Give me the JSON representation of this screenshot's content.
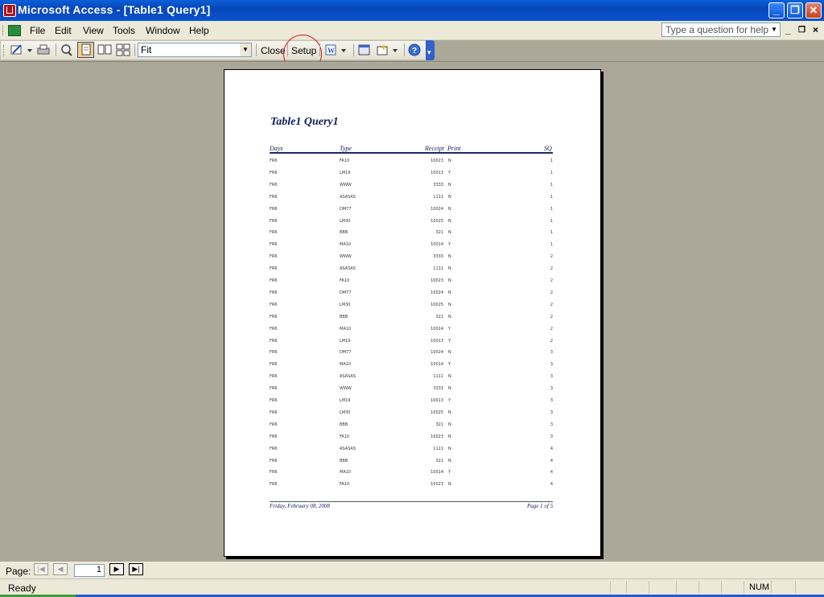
{
  "window": {
    "title": "Microsoft Access - [Table1 Query1]"
  },
  "menu": {
    "file": "File",
    "edit": "Edit",
    "view": "View",
    "tools": "Tools",
    "window": "Window",
    "help": "Help",
    "help_placeholder": "Type a question for help"
  },
  "toolbar": {
    "zoom_value": "Fit",
    "close_label": "Close",
    "setup_label": "Setup"
  },
  "report": {
    "title": "Table1 Query1",
    "columns": {
      "days": "Days",
      "type": "Type",
      "receipt": "Receipt",
      "print": "Print",
      "sq": "SQ"
    },
    "rows": [
      {
        "days": "FR6",
        "type": "FA10",
        "receipt": "10023",
        "print": "N",
        "sq": "1"
      },
      {
        "days": "FR6",
        "type": "LM19",
        "receipt": "10013",
        "print": "Y",
        "sq": "1"
      },
      {
        "days": "FR6",
        "type": "WWW",
        "receipt": "3333",
        "print": "N",
        "sq": "1"
      },
      {
        "days": "FR6",
        "type": "ASASAS",
        "receipt": "1111",
        "print": "N",
        "sq": "1"
      },
      {
        "days": "FR6",
        "type": "DM77",
        "receipt": "10024",
        "print": "N",
        "sq": "1"
      },
      {
        "days": "FR6",
        "type": "LM30",
        "receipt": "10025",
        "print": "N",
        "sq": "1"
      },
      {
        "days": "FR6",
        "type": "BBB",
        "receipt": "321",
        "print": "N",
        "sq": "1"
      },
      {
        "days": "FR6",
        "type": "MA10",
        "receipt": "10014",
        "print": "Y",
        "sq": "1"
      },
      {
        "days": "FR6",
        "type": "WWW",
        "receipt": "3333",
        "print": "N",
        "sq": "2"
      },
      {
        "days": "FR6",
        "type": "ASASAS",
        "receipt": "1111",
        "print": "N",
        "sq": "2"
      },
      {
        "days": "FR6",
        "type": "FA10",
        "receipt": "10023",
        "print": "N",
        "sq": "2"
      },
      {
        "days": "FR6",
        "type": "DM77",
        "receipt": "10024",
        "print": "N",
        "sq": "2"
      },
      {
        "days": "FR6",
        "type": "LM30",
        "receipt": "10025",
        "print": "N",
        "sq": "2"
      },
      {
        "days": "FR6",
        "type": "BBB",
        "receipt": "321",
        "print": "N",
        "sq": "2"
      },
      {
        "days": "FR6",
        "type": "MA10",
        "receipt": "10014",
        "print": "Y",
        "sq": "2"
      },
      {
        "days": "FR6",
        "type": "LM19",
        "receipt": "10013",
        "print": "Y",
        "sq": "2"
      },
      {
        "days": "FR6",
        "type": "DM77",
        "receipt": "10024",
        "print": "N",
        "sq": "3"
      },
      {
        "days": "FR6",
        "type": "MA10",
        "receipt": "10014",
        "print": "Y",
        "sq": "3"
      },
      {
        "days": "FR6",
        "type": "ASASAS",
        "receipt": "1111",
        "print": "N",
        "sq": "3"
      },
      {
        "days": "FR6",
        "type": "WWW",
        "receipt": "3333",
        "print": "N",
        "sq": "3"
      },
      {
        "days": "FR6",
        "type": "LM19",
        "receipt": "10013",
        "print": "Y",
        "sq": "3"
      },
      {
        "days": "FR6",
        "type": "LM30",
        "receipt": "10025",
        "print": "N",
        "sq": "3"
      },
      {
        "days": "FR6",
        "type": "BBB",
        "receipt": "321",
        "print": "N",
        "sq": "3"
      },
      {
        "days": "FR6",
        "type": "FA10",
        "receipt": "10023",
        "print": "N",
        "sq": "3"
      },
      {
        "days": "FR6",
        "type": "ASASAS",
        "receipt": "1111",
        "print": "N",
        "sq": "4"
      },
      {
        "days": "FR6",
        "type": "BBB",
        "receipt": "321",
        "print": "N",
        "sq": "4"
      },
      {
        "days": "FR6",
        "type": "MA10",
        "receipt": "10014",
        "print": "Y",
        "sq": "4"
      },
      {
        "days": "FR6",
        "type": "FA10",
        "receipt": "10023",
        "print": "N",
        "sq": "4"
      }
    ],
    "footer_date": "Friday, February 08, 2008",
    "footer_page": "Page 1 of 5"
  },
  "navigation": {
    "page_label": "Page:",
    "current_page": "1"
  },
  "status": {
    "text": "Ready",
    "num": "NUM"
  }
}
